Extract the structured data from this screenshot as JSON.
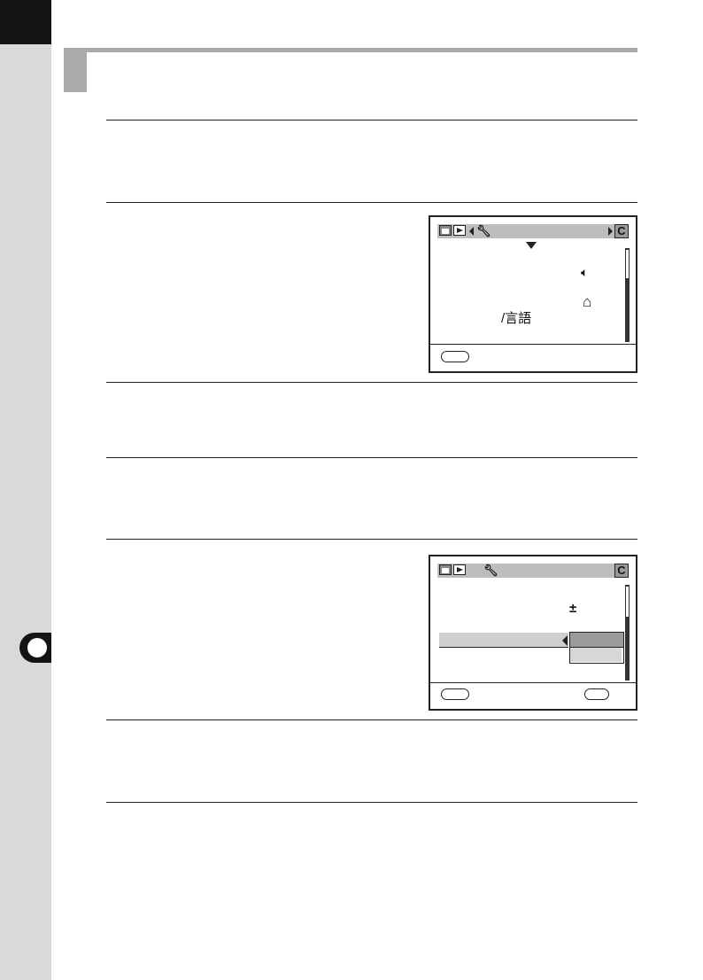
{
  "colors": {
    "sidebar": "#d9d9d9",
    "accent_black": "#141414",
    "section_bar": "#aaaaaa",
    "highlight": "#cfcfcf"
  },
  "screen1": {
    "tab_icons": [
      "camera-icon",
      "playback-icon",
      "wrench-icon"
    ],
    "c_tab": "C",
    "menu_icons": [
      "speaker-icon",
      "home-icon"
    ],
    "language_label": "/言語"
  },
  "screen2": {
    "tab_icons": [
      "camera-icon",
      "playback-icon",
      "wrench-icon"
    ],
    "c_tab": "C",
    "plus_minus": "±"
  }
}
